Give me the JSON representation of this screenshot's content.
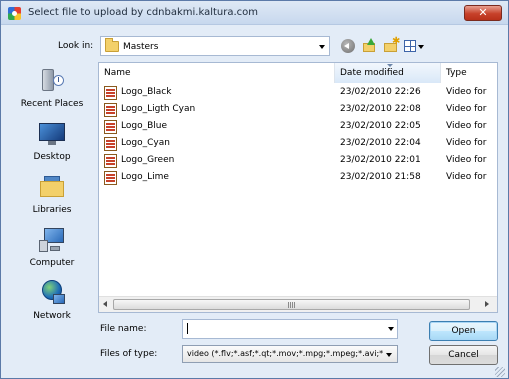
{
  "window": {
    "title": "Select file to upload by cdnbakmi.kaltura.com",
    "close_label": "✕"
  },
  "toolbar": {
    "look_in_label": "Look in:",
    "look_in_value": "Masters",
    "icons": [
      "back-icon",
      "up-folder-icon",
      "new-folder-icon",
      "views-icon"
    ]
  },
  "places": [
    {
      "label": "Recent Places",
      "icon": "recent-places-icon"
    },
    {
      "label": "Desktop",
      "icon": "desktop-icon"
    },
    {
      "label": "Libraries",
      "icon": "libraries-icon"
    },
    {
      "label": "Computer",
      "icon": "computer-icon"
    },
    {
      "label": "Network",
      "icon": "network-icon"
    }
  ],
  "file_list": {
    "columns": {
      "name": "Name",
      "date": "Date modified",
      "type": "Type"
    },
    "rows": [
      {
        "name": "Logo_Black",
        "date": "23/02/2010 22:26",
        "type": "Video for"
      },
      {
        "name": "Logo_Ligth Cyan",
        "date": "23/02/2010 22:08",
        "type": "Video for"
      },
      {
        "name": "Logo_Blue",
        "date": "23/02/2010 22:05",
        "type": "Video for"
      },
      {
        "name": "Logo_Cyan",
        "date": "23/02/2010 22:04",
        "type": "Video for"
      },
      {
        "name": "Logo_Green",
        "date": "23/02/2010 22:01",
        "type": "Video for"
      },
      {
        "name": "Logo_Lime",
        "date": "23/02/2010 21:58",
        "type": "Video for"
      }
    ]
  },
  "footer": {
    "file_name_label": "File name:",
    "file_name_value": "",
    "file_type_label": "Files of type:",
    "file_type_value": "video (*.flv;*.asf;*.qt;*.mov;*.mpg;*.mpeg;*.avi;*",
    "open_label": "Open",
    "cancel_label": "Cancel"
  }
}
